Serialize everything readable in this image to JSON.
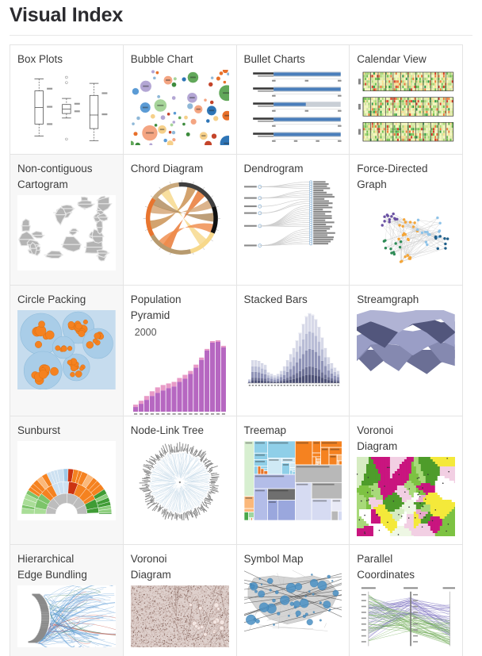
{
  "header": {
    "title": "Visual Index"
  },
  "grid": {
    "columns": 4,
    "rows": 5,
    "cells": [
      {
        "label": "Box Plots",
        "icon": "box-plot-thumbnail",
        "shaded": false
      },
      {
        "label": "Bubble Chart",
        "icon": "bubble-chart-thumbnail",
        "shaded": false
      },
      {
        "label": "Bullet Charts",
        "icon": "bullet-chart-thumbnail",
        "shaded": false
      },
      {
        "label": "Calendar View",
        "icon": "calendar-view-thumbnail",
        "shaded": false
      },
      {
        "label": "Non-contiguous\nCartogram",
        "icon": "cartogram-thumbnail",
        "shaded": true
      },
      {
        "label": "Chord Diagram",
        "icon": "chord-diagram-thumbnail",
        "shaded": false
      },
      {
        "label": "Dendrogram",
        "icon": "dendrogram-thumbnail",
        "shaded": false
      },
      {
        "label": "Force-Directed\nGraph",
        "icon": "force-directed-graph-thumbnail",
        "shaded": false
      },
      {
        "label": "Circle Packing",
        "icon": "circle-packing-thumbnail",
        "shaded": true
      },
      {
        "label": "Population\nPyramid",
        "icon": "population-pyramid-thumbnail",
        "shaded": false,
        "sublabel": "2000"
      },
      {
        "label": "Stacked Bars",
        "icon": "stacked-bars-thumbnail",
        "shaded": false
      },
      {
        "label": "Streamgraph",
        "icon": "streamgraph-thumbnail",
        "shaded": false
      },
      {
        "label": "Sunburst",
        "icon": "sunburst-thumbnail",
        "shaded": true
      },
      {
        "label": "Node-Link Tree",
        "icon": "node-link-tree-thumbnail",
        "shaded": false
      },
      {
        "label": "Treemap",
        "icon": "treemap-thumbnail",
        "shaded": false
      },
      {
        "label": "Voronoi\nDiagram",
        "icon": "voronoi-diagram-thumbnail",
        "shaded": false
      },
      {
        "label": "Hierarchical\nEdge Bundling",
        "icon": "edge-bundling-thumbnail",
        "shaded": true
      },
      {
        "label": "Voronoi\nDiagram",
        "icon": "voronoi-points-thumbnail",
        "shaded": false
      },
      {
        "label": "Symbol Map",
        "icon": "symbol-map-thumbnail",
        "shaded": false
      },
      {
        "label": "Parallel\nCoordinates",
        "icon": "parallel-coordinates-thumbnail",
        "shaded": false
      }
    ]
  },
  "thumbnails": {
    "bullet_charts": {
      "rows": [
        {
          "label": "Revenue",
          "sublabel": "U.S. Thousands",
          "ticks": [
            "0",
            "50",
            "1"
          ],
          "value": 100,
          "range": 100
        },
        {
          "label": "Profit",
          "sublabel": "%",
          "ticks": [
            "0",
            "5"
          ],
          "value": 100,
          "range": 100
        },
        {
          "label": "Order Size",
          "sublabel": "US$ average",
          "ticks": [
            "0",
            "100",
            "2"
          ],
          "value": 48,
          "range": 100
        },
        {
          "label": "Customers",
          "sublabel": "count",
          "ticks": [
            "0",
            "500"
          ],
          "value": 100,
          "range": 100
        },
        {
          "label": "Satisfaction",
          "sublabel": "out of 5",
          "ticks": [
            "0.0",
            "0.5",
            "1.0",
            "1.5"
          ],
          "value": 100,
          "range": 100
        }
      ]
    },
    "population_pyramid": {
      "year": "2000",
      "bars": [
        6,
        10,
        15,
        20,
        24,
        27,
        30,
        32,
        38,
        42,
        48,
        56,
        66,
        78,
        88,
        89,
        82
      ],
      "tops": [
        3,
        4,
        5,
        6,
        7,
        7,
        6,
        6,
        5,
        5,
        4,
        4,
        3,
        2,
        2,
        2,
        2
      ]
    },
    "stacked_bars": {
      "values": [
        5,
        30,
        30,
        29,
        26,
        24,
        14,
        12,
        10,
        12,
        16,
        22,
        30,
        38,
        46,
        56,
        66,
        78,
        88,
        92,
        90,
        84,
        74,
        60,
        46,
        34,
        26,
        20,
        16
      ]
    },
    "colors": {
      "grid_line": "#e4e4e4",
      "row_shade": "#f7f7f7",
      "title_text": "#2b2b2f",
      "cell_text": "#3c3c3c",
      "bullet_bar": "#4a7ebb",
      "bullet_track": "#c9cfd6",
      "pyramid_body": "#b667c1",
      "pyramid_top": "#e89ac7",
      "stream_dark": "#5a5f82",
      "stream_mid": "#7b7fa8",
      "stream_light": "#9a9ec6",
      "circle_pack_bg": "#c6dcee",
      "circle_pack_node": "#f58220",
      "voronoi_green": "#7dc242",
      "voronoi_magenta": "#c9157f",
      "voronoi_pink": "#e8a8cd",
      "symbol_map_dot": "#4a90c4",
      "treemap_orange": "#f58220",
      "treemap_blue": "#9aa7dd"
    }
  }
}
